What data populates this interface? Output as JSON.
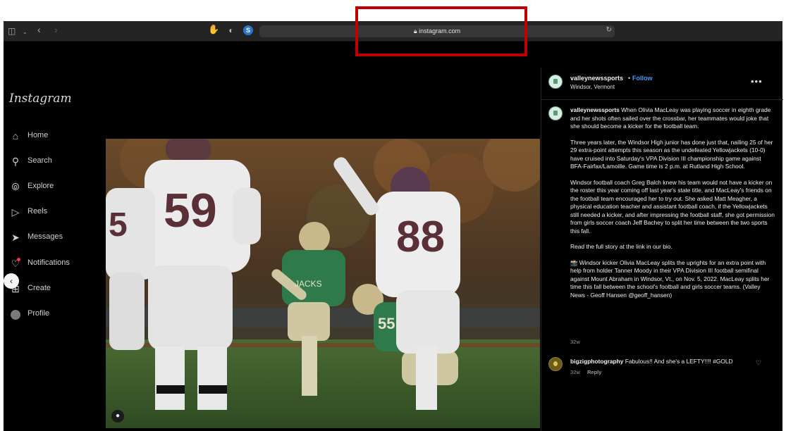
{
  "browser": {
    "url": "instagram.com",
    "icons": {
      "sidebar_toggle": "sidebar-icon",
      "chevron": "chevron-down-icon",
      "back": "back-arrow-icon",
      "forward": "forward-arrow-icon",
      "lock": "lock-icon",
      "reload": "reload-icon"
    }
  },
  "instagram": {
    "logo": "Instagram",
    "nav": [
      {
        "label": "Home",
        "icon": "home-icon"
      },
      {
        "label": "Search",
        "icon": "search-icon"
      },
      {
        "label": "Explore",
        "icon": "compass-icon"
      },
      {
        "label": "Reels",
        "icon": "reels-icon"
      },
      {
        "label": "Messages",
        "icon": "paper-plane-icon"
      },
      {
        "label": "Notifications",
        "icon": "heart-icon"
      },
      {
        "label": "Create",
        "icon": "plus-icon"
      },
      {
        "label": "Profile",
        "icon": "profile-avatar"
      }
    ],
    "post": {
      "username": "valleynewssports",
      "dot": "•",
      "follow": "Follow",
      "location": "Windsor, Vermont",
      "caption_paragraphs": [
        "When Olivia MacLeay was playing soccer in eighth grade and her shots often sailed over the crossbar, her teammates would joke that she should become a kicker for the football team.",
        "Three years later, the Windsor High junior has done just that, nailing 25 of her 29 extra-point attempts this season as the undefeated Yellowjackets (10-0) have cruised into Saturday's VPA Division III championship game against BFA-Fairfax/Lamoille. Game time is 2 p.m. at Rutland High School.",
        "Windsor football coach Greg Balch knew his team would not have a kicker on the roster this year coming off last year's state title, and MacLeay's friends on the football team encouraged her to try out. She asked Matt Meagher, a physical education teacher and assistant football coach, if the Yellowjackets still needed a kicker, and after impressing the football staff, she got permission from girls soccer coach Jeff Bachey to split her time between the two sports this fall.",
        "Read the full story at the link in our bio.",
        "📸 Windsor kicker Olivia MacLeay splits the uprights for an extra point with help from holder Tanner Moody in their VPA Division III football semifinal against Mount Abraham in Windsor, Vt., on Nov. 5, 2022. MacLeay splits her time this fall between the school's football and girls soccer teams. (Valley News - Geoff Hansen @geoff_hansen)"
      ],
      "caption_age": "32w",
      "comment": {
        "username": "bigzigphotography",
        "text": "Fabulous!! And she's a LEFTY!!!! #GOLD",
        "age": "32w",
        "reply": "Reply"
      },
      "jersey_numbers": [
        "59",
        "88",
        "5",
        "55"
      ]
    }
  },
  "colors": {
    "annotation_box": "#c00000",
    "follow": "#3b9ef5",
    "background": "#000000"
  }
}
